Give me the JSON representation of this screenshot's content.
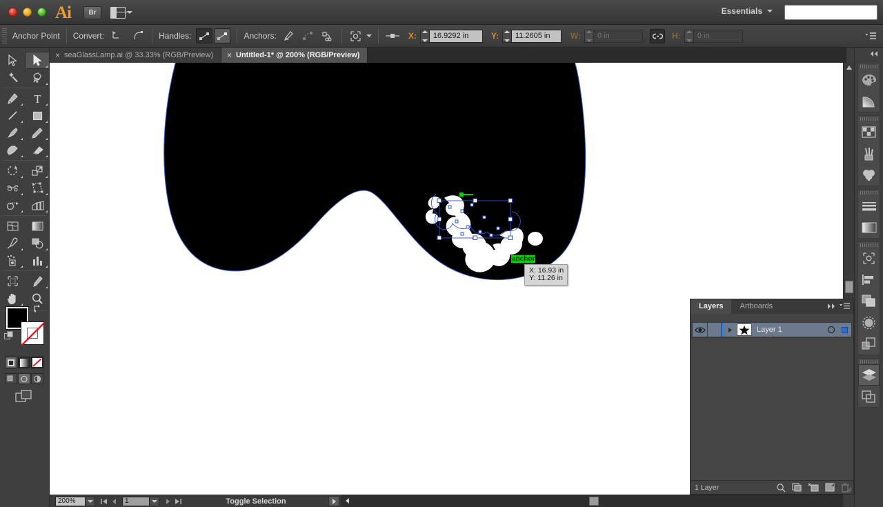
{
  "titlebar": {
    "app_logo": "Ai",
    "bridge_label": "Br",
    "arrange_icon": "arrange-documents-icon",
    "workspace_label": "Essentials",
    "search_value": "",
    "search_placeholder": ""
  },
  "controlbar": {
    "selection_label": "Anchor Point",
    "convert_label": "Convert:",
    "convert_tools": [
      "convert-to-corner-icon",
      "convert-to-smooth-icon"
    ],
    "handles_label": "Handles:",
    "handle_tools": [
      "show-handles-icon",
      "hide-handles-icon"
    ],
    "anchors_label": "Anchors:",
    "anchor_tools": [
      "remove-anchor-icon",
      "connect-anchors-icon",
      "cut-path-icon"
    ],
    "isolate_label": "isolate-selected-object-icon",
    "align_label": "align-to-icon",
    "x_label": "X:",
    "x_value": "16.9292 in",
    "y_label": "Y:",
    "y_value": "11.2605 in",
    "w_label": "W:",
    "w_value": "0 in",
    "h_label": "H:",
    "h_value": "0 in",
    "link_icon": "link-dimensions-icon",
    "panel_menu_icon": "control-panel-menu-icon"
  },
  "tabs": [
    {
      "label": "seaGlassLamp.ai @ 33.33% (RGB/Preview)",
      "active": false,
      "close": "×"
    },
    {
      "label": "Untitled-1* @ 200% (RGB/Preview)",
      "active": true,
      "close": "×"
    }
  ],
  "tools": {
    "column_left": [
      "selection-tool-icon",
      "magic-wand-tool-icon",
      "pen-tool-icon",
      "line-segment-tool-icon",
      "paintbrush-tool-icon",
      "blob-brush-tool-icon",
      "rotate-tool-icon",
      "width-tool-icon",
      "shape-builder-tool-icon",
      "mesh-tool-icon",
      "eyedropper-tool-icon",
      "symbol-sprayer-tool-icon",
      "artboard-tool-icon",
      "hand-tool-icon"
    ],
    "column_right": [
      "direct-selection-tool-icon",
      "lasso-tool-icon",
      "type-tool-icon",
      "rectangle-tool-icon",
      "pencil-tool-icon",
      "eraser-tool-icon",
      "scale-tool-icon",
      "free-transform-tool-icon",
      "perspective-grid-tool-icon",
      "graph-tool-icon",
      "gradient-tool-icon",
      "blend-tool-icon",
      "slice-tool-icon",
      "zoom-tool-icon"
    ],
    "active_tool": "direct-selection-tool-icon",
    "fill_color": "#000000",
    "stroke_color": "none",
    "fill_icon": "fill-swatch",
    "stroke_icon": "stroke-swatch",
    "swap_icon": "swap-fill-stroke-icon",
    "default_icon": "default-fill-stroke-icon",
    "color_modes": [
      "color-swatch-icon",
      "gradient-swatch-icon",
      "none-swatch-icon"
    ],
    "draw_modes": [
      "draw-normal-icon",
      "draw-behind-icon",
      "draw-inside-icon"
    ],
    "screen_mode": "change-screen-mode-icon"
  },
  "canvas": {
    "smart_guide_label": "anchor",
    "tooltip_x": "X: 16.93 in",
    "tooltip_y": "Y: 11.26 in",
    "artwork_fill": "#000000",
    "selection_color": "#2b55d8",
    "guide_color": "#00d200"
  },
  "statusbar": {
    "zoom_value": "200%",
    "zoom_dropdown_icon": "chevron-down-icon",
    "first_artboard_icon": "first-artboard-icon",
    "prev_artboard_icon": "previous-artboard-icon",
    "artboard_value": "1",
    "artboard_dropdown_icon": "chevron-down-icon",
    "next_artboard_icon": "next-artboard-icon",
    "last_artboard_icon": "last-artboard-icon",
    "status_text": "Toggle Selection",
    "status_menu_icon": "status-menu-icon",
    "hscroll_left_icon": "scroll-left-icon"
  },
  "layers_panel": {
    "tabs": [
      {
        "label": "Layers",
        "active": true
      },
      {
        "label": "Artboards",
        "active": false
      }
    ],
    "collapse_icon": "collapse-panel-icon",
    "menu_icon": "panel-menu-icon",
    "rows": [
      {
        "name": "Layer 1",
        "visibility_icon": "eye-icon",
        "expand_icon": "expand-triangle-icon",
        "thumbnail_icon": "layer-thumbnail-star",
        "target_icon": "target-circle-icon",
        "selected": true
      }
    ],
    "footer_count": "1 Layer",
    "footer_icons": [
      "locate-object-icon",
      "make-clipping-mask-icon",
      "create-new-sublayer-icon",
      "create-new-layer-icon",
      "delete-selection-icon"
    ]
  },
  "right_dock": {
    "collapse_icon": "collapse-to-icons-icon",
    "groups": [
      {
        "icons": [
          "color-panel-icon",
          "color-guide-panel-icon"
        ]
      },
      {
        "icons": [
          "swatches-panel-icon",
          "brushes-panel-icon",
          "symbols-panel-icon"
        ]
      },
      {
        "icons": [
          "stroke-panel-icon",
          "gradient-panel-icon"
        ]
      },
      {
        "icons": [
          "transform-panel-icon",
          "align-panel-icon",
          "pathfinder-panel-icon",
          "transparency-panel-icon",
          "appearance-panel-icon"
        ]
      },
      {
        "icons": [
          "layers-panel-icon",
          "artboards-panel-icon"
        ],
        "active": "layers-panel-icon"
      }
    ]
  }
}
